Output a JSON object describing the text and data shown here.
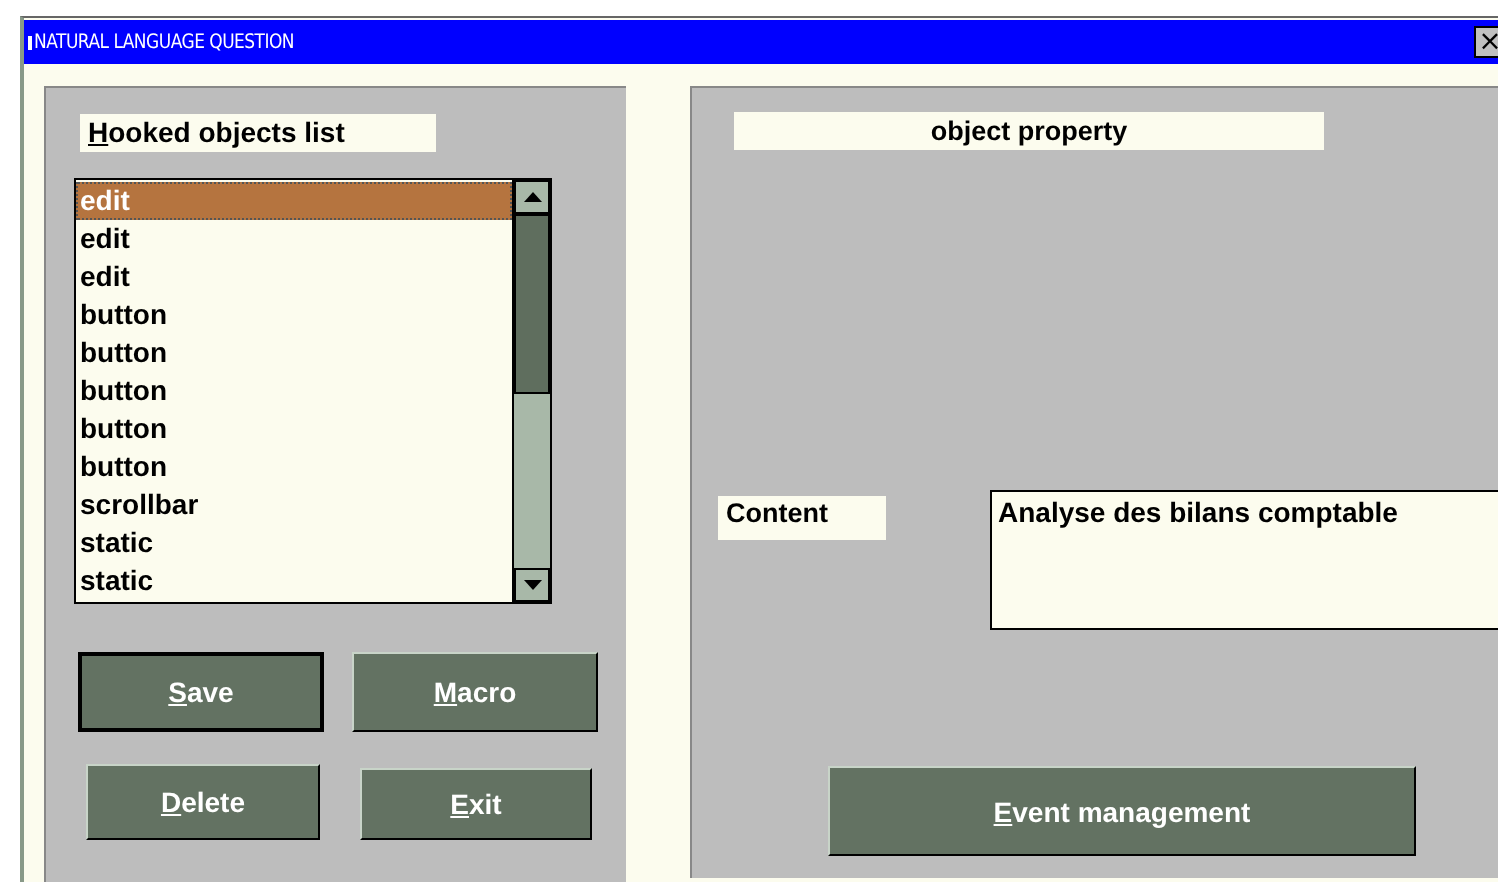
{
  "window": {
    "title": "NATURAL LANGUAGE QUESTION",
    "close": "×"
  },
  "left_panel": {
    "heading": {
      "text": "Hooked objects list",
      "underline_first": true
    },
    "list_items": [
      {
        "label": "edit",
        "selected": true
      },
      {
        "label": "edit",
        "selected": false
      },
      {
        "label": "edit",
        "selected": false
      },
      {
        "label": "button",
        "selected": false
      },
      {
        "label": "button",
        "selected": false
      },
      {
        "label": "button",
        "selected": false
      },
      {
        "label": "button",
        "selected": false
      },
      {
        "label": "button",
        "selected": false
      },
      {
        "label": "scrollbar",
        "selected": false
      },
      {
        "label": "static",
        "selected": false
      },
      {
        "label": "static",
        "selected": false
      }
    ],
    "buttons": [
      {
        "label": "Save",
        "underline_first": true,
        "default": true
      },
      {
        "label": "Macro",
        "underline_first": true,
        "default": false
      },
      {
        "label": "Delete",
        "underline_first": true,
        "default": false
      },
      {
        "label": "Exit",
        "underline_first": true,
        "default": false
      }
    ]
  },
  "right_panel": {
    "heading": "object property",
    "content_label": "Content",
    "content_value": "Analyse des bilans comptable",
    "button": {
      "label": "Event management",
      "underline_first": true,
      "default": false
    }
  }
}
